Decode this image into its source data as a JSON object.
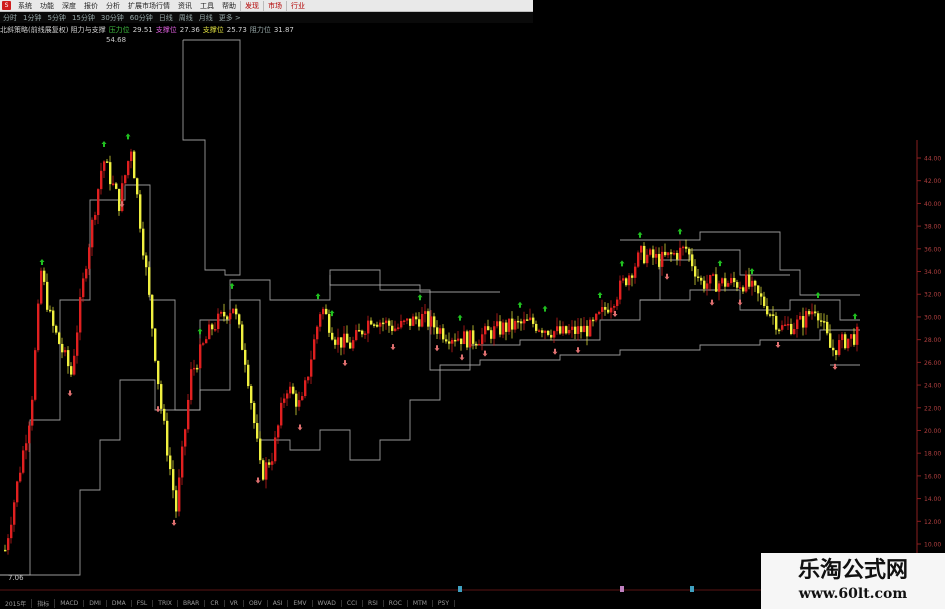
{
  "menubar": {
    "items": [
      "系统",
      "功能",
      "深度",
      "报价",
      "分析",
      "扩展市场行情",
      "资讯",
      "工具",
      "帮助"
    ],
    "highlight_items": [
      "发现",
      "市场",
      "行业"
    ]
  },
  "periodbar": {
    "items": [
      "分时",
      "1分钟",
      "5分钟",
      "15分钟",
      "30分钟",
      "60分钟",
      "日线",
      "周线",
      "月线",
      "更多 >"
    ]
  },
  "indicator": {
    "name": "北斜策略(前线展复权) 阻力与支撑",
    "resistance_label": "压力位",
    "resistance_value": "29.51",
    "support_label": "支撑位",
    "support_value": "27.36",
    "support2_label": "支撑位",
    "support2_value": "25.73",
    "pressure_label": "阻力位",
    "pressure_value": "31.87"
  },
  "chart_data": {
    "type": "candlestick",
    "y_axis_ticks": [
      "44.00",
      "42.00",
      "40.00",
      "38.00",
      "36.00",
      "34.00",
      "32.00",
      "30.00",
      "28.00",
      "26.00",
      "24.00",
      "22.00",
      "20.00",
      "18.00",
      "16.00",
      "14.00",
      "12.00",
      "10.00"
    ],
    "high_label": "54.68",
    "low_label": "7.06",
    "colors": {
      "up": "#e02020",
      "down": "#f0f040",
      "line": "#b4b4b4",
      "axis": "#8a1f1f",
      "buy_arrow": "#20c020",
      "sell_arrow": "#e07070"
    }
  },
  "bottombar": {
    "items": [
      "2015年",
      "指标",
      "MACD",
      "DMI",
      "DMA",
      "FSL",
      "TRIX",
      "BRAR",
      "CR",
      "VR",
      "OBV",
      "ASI",
      "EMV",
      "WVAD",
      "CCI",
      "RSI",
      "ROC",
      "MTM",
      "PSY"
    ]
  },
  "watermark": {
    "title": "乐淘公式网",
    "url": "www.60lt.com"
  }
}
